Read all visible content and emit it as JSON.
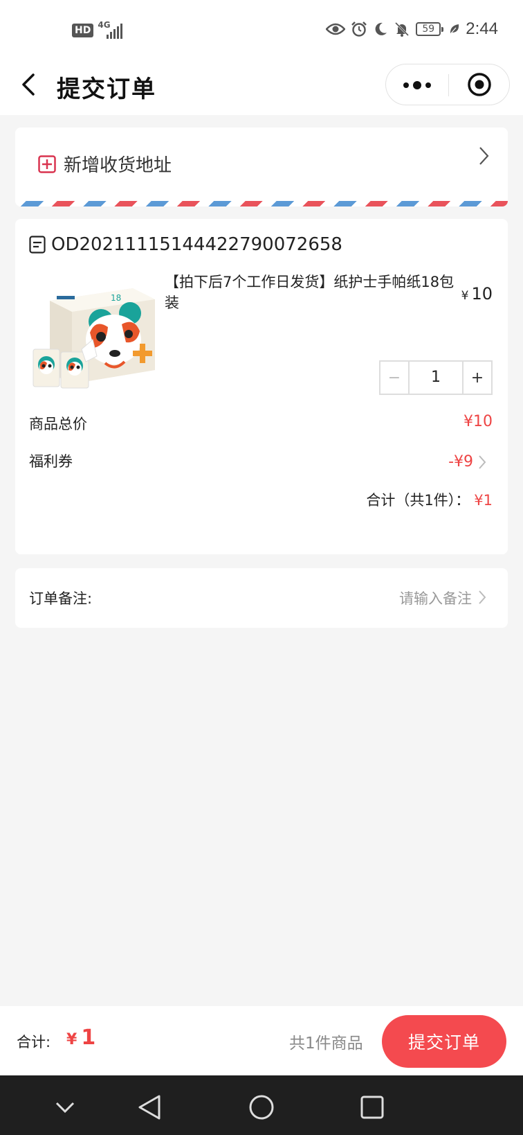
{
  "status_bar": {
    "hd_badge": "HD",
    "network": "4G",
    "battery": "59",
    "time": "2:44",
    "icons": [
      "eye-icon",
      "alarm-icon",
      "moon-icon",
      "bell-off-icon",
      "battery-icon",
      "leaf-icon"
    ]
  },
  "nav": {
    "title": "提交订单",
    "back_icon": "chevron-left-icon",
    "more_icon": "more-dots-icon",
    "close_icon": "target-circle-icon"
  },
  "address": {
    "label": "新增收货地址",
    "icon": "plus-square-icon"
  },
  "order": {
    "number": "OD20211115144422790072658",
    "product_title": "【拍下后7个工作日发货】纸护士手帕纸18包装",
    "price_currency": "¥",
    "price": "10",
    "stepper": {
      "minus": "−",
      "quantity": "1",
      "plus": "+"
    },
    "subtotal_label": "商品总价",
    "subtotal_value": "¥10",
    "coupon_label": "福利券",
    "coupon_value": "-¥9",
    "total_label": "合计（共1件）：",
    "total_value": "¥1"
  },
  "remark": {
    "label": "订单备注:",
    "placeholder": "请输入备注"
  },
  "bottom_bar": {
    "total_label": "合计:",
    "currency": "¥",
    "total_amount": "1",
    "item_count": "共1件商品",
    "submit_label": "提交订单"
  },
  "colors": {
    "accent_red": "#f44a4f",
    "price_red": "#ee4444",
    "airmail_red": "#e9535b",
    "airmail_blue": "#5c9ad6",
    "background": "#f5f5f5"
  }
}
